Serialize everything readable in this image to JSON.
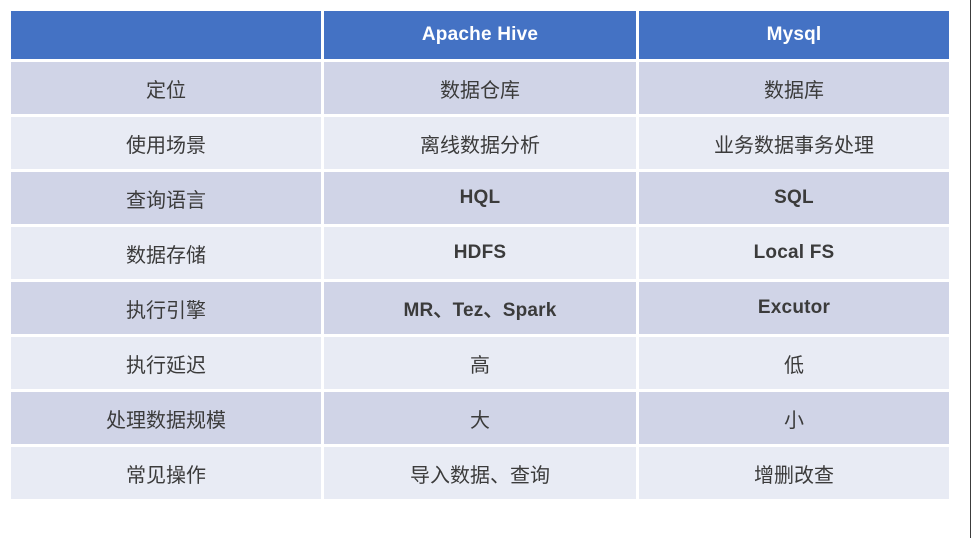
{
  "table": {
    "columns": [
      {
        "key": "attribute",
        "label": ""
      },
      {
        "key": "hive",
        "label": "Apache Hive"
      },
      {
        "key": "mysql",
        "label": "Mysql"
      }
    ],
    "rows": [
      {
        "attribute": "定位",
        "hive": "数据仓库",
        "mysql": "数据库",
        "hive_latin": false,
        "mysql_latin": false
      },
      {
        "attribute": "使用场景",
        "hive": "离线数据分析",
        "mysql": "业务数据事务处理",
        "hive_latin": false,
        "mysql_latin": false
      },
      {
        "attribute": "查询语言",
        "hive": "HQL",
        "mysql": "SQL",
        "hive_latin": true,
        "mysql_latin": true
      },
      {
        "attribute": "数据存储",
        "hive": "HDFS",
        "mysql": "Local FS",
        "hive_latin": true,
        "mysql_latin": true
      },
      {
        "attribute": "执行引擎",
        "hive": "MR、Tez、Spark",
        "mysql": "Excutor",
        "hive_latin": true,
        "mysql_latin": true
      },
      {
        "attribute": "执行延迟",
        "hive": "高",
        "mysql": "低",
        "hive_latin": false,
        "mysql_latin": false
      },
      {
        "attribute": "处理数据规模",
        "hive": "大",
        "mysql": "小",
        "hive_latin": false,
        "mysql_latin": false
      },
      {
        "attribute": "常见操作",
        "hive": "导入数据、查询",
        "mysql": "增删改查",
        "hive_latin": false,
        "mysql_latin": false
      }
    ]
  },
  "colors": {
    "header_background": "#4472c4",
    "header_text": "#ffffff",
    "row_shade_dark": "#d0d4e7",
    "row_shade_light": "#e8ebf4",
    "body_text": "#3b3b3b",
    "page_background": "#ffffff",
    "edge_rule": "#3c3c3c"
  }
}
